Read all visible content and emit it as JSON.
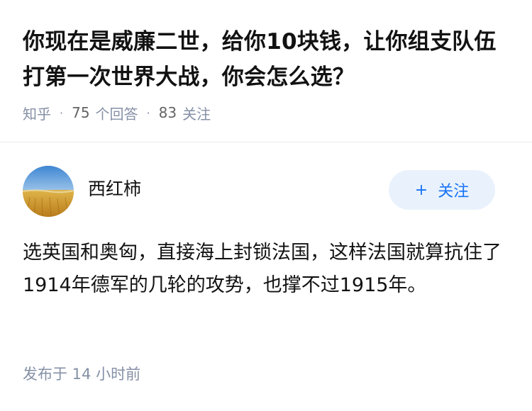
{
  "question": {
    "title": "你现在是威廉二世，给你10块钱，让你组支队伍打第一次世界大战，你会怎么选？",
    "source": "知乎",
    "separator": "·",
    "answer_count": "75",
    "answer_label": "个回答",
    "follower_count": "83",
    "follower_label": "关注"
  },
  "answer": {
    "author_name": "西红柿",
    "follow_plus": "+",
    "follow_label": "关注",
    "content": "选英国和奥匈，直接海上封锁法国，这样法国就算抗住了1914年德军的几轮的攻势，也撑不过1915年。",
    "published": "发布于  14 小时前"
  },
  "colors": {
    "accent": "#1772f6",
    "follow_bg": "#e9f2fc",
    "meta_text": "#8590a6",
    "title_text": "#121212"
  }
}
